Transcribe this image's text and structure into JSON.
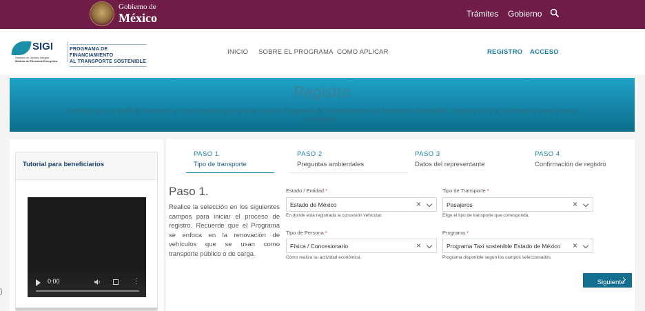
{
  "gov": {
    "line1": "Gobierno de",
    "line2": "México",
    "nav": [
      "Trámites",
      "Gobierno"
    ]
  },
  "program": {
    "logo_title": "SIGI",
    "logo_sub1": "Sistema de Gestión Integral",
    "logo_sub2": "Módulo de Eficiencia Energética",
    "title_line1": "PROGRAMA DE FINANCIAMIENTO",
    "title_line2": "AL TRANSPORTE SOSTENIBLE",
    "nav": [
      "INICIO",
      "SOBRE EL PROGRAMA",
      "COMO APLICAR"
    ],
    "nav_right": [
      "REGISTRO",
      "ACCESO"
    ]
  },
  "banner": {
    "title": "Registro",
    "text": "Verifique que su perfil de empresa o concesionario aplica para nuestro Programa de Financiamiento al Transporte Sostenible. Capture toda la información para obtener su registro."
  },
  "sidebar": {
    "title": "Tutorial para beneficiarios",
    "video_time": "0:00"
  },
  "steps": [
    {
      "num": "PASO 1",
      "label": "Tipo de transporte"
    },
    {
      "num": "PASO 2",
      "label": "Preguntas ambientales"
    },
    {
      "num": "PASO 3",
      "label": "Datos del representante"
    },
    {
      "num": "PASO 4",
      "label": "Confirmación de registro"
    }
  ],
  "paso": {
    "title": "Paso 1.",
    "description": "Realice la selección en los siguientes campos para iniciar el proceso de registro. Recuerde que el Programa se enfoca en la renovación de vehículos que se usan como transporte público o de carga."
  },
  "fields": {
    "estado": {
      "label": "Estado / Entidad",
      "value": "Estado de México",
      "help": "En donde está registrada la concesión vehicular."
    },
    "tipo_transporte": {
      "label": "Tipo de Transporte",
      "value": "Pasajeros",
      "help": "Elige el tipo de transporte que corresponda."
    },
    "tipo_persona": {
      "label": "Tipo de Persona",
      "value": "Física / Concesionario",
      "help": "Como realiza su actividad económica."
    },
    "programa": {
      "label": "Programa",
      "value": "Programa Taxi sostenible Estado de México",
      "help": "Programa disponible según los campos seleccionados."
    }
  },
  "required_mark": "*",
  "next_button": "Siguiente",
  "colors": {
    "gov": "#6f1d46",
    "accent": "#1c7da4",
    "button": "#136e8f"
  }
}
